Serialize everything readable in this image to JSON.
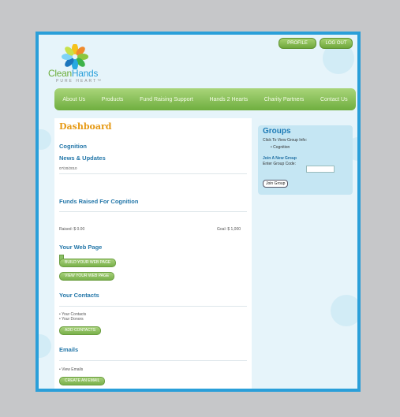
{
  "top": {
    "profile": "PROFILE",
    "logout": "LOG OUT"
  },
  "brand": {
    "clean": "Clean",
    "hands": "Hands",
    "tagline": "PURE HEART™"
  },
  "nav": [
    "About Us",
    "Products",
    "Fund Raising Support",
    "Hands 2 Hearts",
    "Charity Partners",
    "Contact Us"
  ],
  "main": {
    "dashboard": "Dashboard",
    "group_name": "Cognition",
    "news_title": "News & Updates",
    "news_date": "07/20/2010",
    "funds_title": "Funds Raised For Cognition",
    "progress_fraction": 0.0,
    "raised": "Raised: $ 0.00",
    "goal": "Goal: $ 1,000",
    "web_title": "Your Web Page",
    "build_btn": "BUILD YOUR WEB PAGE",
    "view_btn": "VIEW YOUR WEB PAGE",
    "contacts_title": "Your Contacts",
    "contacts_items": [
      "Your Contacts",
      "Your Donors"
    ],
    "add_contacts": "ADD CONTACTS",
    "emails_title": "Emails",
    "emails_items": [
      "View Emails"
    ],
    "create_email": "CREATE AN EMAIL"
  },
  "groups": {
    "title": "Groups",
    "click_text": "Click To View Group Info:",
    "items": [
      "Cognition"
    ],
    "join_title": "Join A New Group",
    "code_label": "Enter Group Code:",
    "code_value": "",
    "join_btn": "Join Group"
  }
}
